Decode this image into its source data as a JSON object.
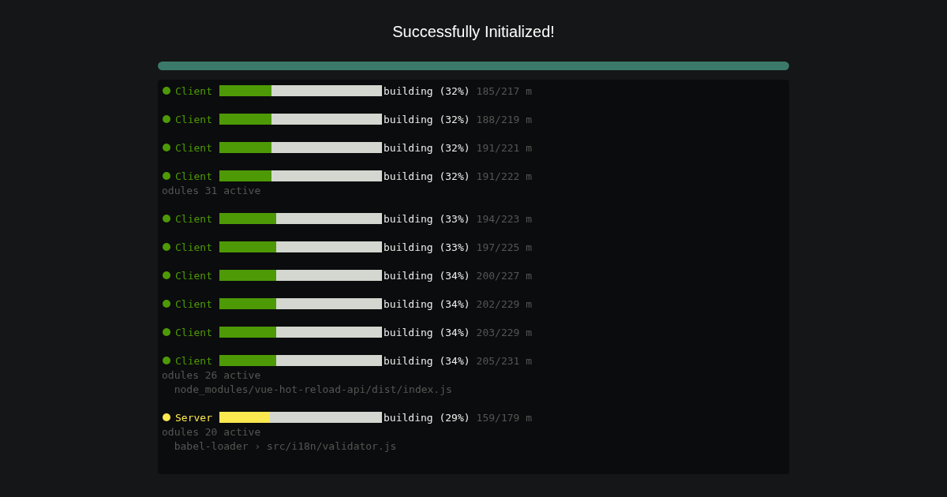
{
  "title": "Successfully Initialized!",
  "progress": {
    "level": 1
  },
  "log": [
    {
      "name": "Client",
      "color": "#4e9a06",
      "level": 0.32,
      "status": "building (32%)",
      "count": "185/217 m"
    },
    {
      "name": "Client",
      "color": "#4e9a06",
      "level": 0.32,
      "status": "building (32%)",
      "count": "188/219 m"
    },
    {
      "name": "Client",
      "color": "#4e9a06",
      "level": 0.32,
      "status": "building (32%)",
      "count": "191/221 m"
    },
    {
      "name": "Client",
      "color": "#4e9a06",
      "level": 0.32,
      "status": "building (32%)",
      "count": "191/222 m",
      "lines": [
        "odules 31 active"
      ]
    },
    {
      "name": "Client",
      "color": "#4e9a06",
      "level": 0.35,
      "status": "building (33%)",
      "count": "194/223 m"
    },
    {
      "name": "Client",
      "color": "#4e9a06",
      "level": 0.35,
      "status": "building (33%)",
      "count": "197/225 m"
    },
    {
      "name": "Client",
      "color": "#4e9a06",
      "level": 0.35,
      "status": "building (34%)",
      "count": "200/227 m"
    },
    {
      "name": "Client",
      "color": "#4e9a06",
      "level": 0.35,
      "status": "building (34%)",
      "count": "202/229 m"
    },
    {
      "name": "Client",
      "color": "#4e9a06",
      "level": 0.35,
      "status": "building (34%)",
      "count": "203/229 m"
    },
    {
      "name": "Client",
      "color": "#4e9a06",
      "level": 0.35,
      "status": "building (34%)",
      "count": "205/231 m",
      "lines": [
        "odules 26 active",
        "  node_modules/vue-hot-reload-api/dist/index.js"
      ]
    },
    {
      "name": "Server",
      "color": "#fce94f",
      "level": 0.31,
      "status": "building (29%)",
      "count": "159/179 m",
      "lines": [
        "odules 20 active",
        "  babel-loader › src/i18n/validator.js"
      ]
    }
  ]
}
